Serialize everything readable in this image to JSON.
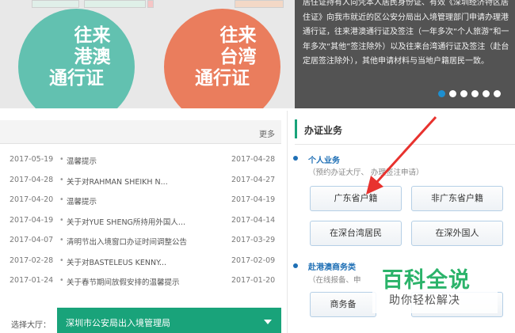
{
  "banner": {
    "left_card": {
      "line1": "往来",
      "line2": "港澳",
      "line3": "通行证"
    },
    "right_card": {
      "line1": "往来",
      "line2": "台湾",
      "line3": "通行证"
    }
  },
  "info_text": "居住证持有人向凭本人居民身份证、有效《深圳经济特区居住证》向我市就近的区公安分局出入境管理部门申请办理港通行证，往来港澳通行证及签注（一年多次“个人旅游”和一年多次“其他”签注除外）以及往来台湾通行证及签注（赴台定居签注除外），其他申请材料与当地户籍居民一致。",
  "carousel": {
    "count": 6,
    "active_index": 0
  },
  "news": {
    "more_label": "更多",
    "items": [
      {
        "date": "2017-05-19",
        "title": "温馨提示",
        "date2": "2017-04-28"
      },
      {
        "date": "2017-04-28",
        "title": "关于对RAHMAN SHEIKH N...",
        "date2": "2017-04-27"
      },
      {
        "date": "2017-04-20",
        "title": "温馨提示",
        "date2": "2017-04-19"
      },
      {
        "date": "2017-04-19",
        "title": "关于对YUE SHENG所持用外国人...",
        "date2": "2017-04-14"
      },
      {
        "date": "2017-04-07",
        "title": "清明节出入境窗口办证时间调整公告",
        "date2": "2017-03-29"
      },
      {
        "date": "2017-02-28",
        "title": "关于对BASTELEUS KENNY...",
        "date2": "2017-02-09"
      },
      {
        "date": "2017-01-24",
        "title": "关于春节期间放假安排的温馨提示",
        "date2": "2017-01-20"
      }
    ]
  },
  "hall": {
    "label": "选择大厅：",
    "selected": "深圳市公安局出入境管理局"
  },
  "services": {
    "title": "办证业务",
    "personal": {
      "title": "个人业务",
      "subtitle": "（预约办证大厅、    办理签注申请）"
    },
    "buttons": [
      "广东省户籍",
      "非广东省户籍",
      "在深台湾居民",
      "在深外国人"
    ],
    "business": {
      "title": "赴港澳商务类",
      "subtitle": "（在线报备、申"
    },
    "business_button": "商务备"
  },
  "watermark": {
    "main": "百科全说",
    "sub": "助你轻松解决"
  },
  "colors": {
    "accent_green": "#19a37a",
    "link_blue": "#1e6fb5",
    "arrow_red": "#e8322e",
    "teal": "#62c1b0",
    "orange": "#ea7d5d"
  }
}
